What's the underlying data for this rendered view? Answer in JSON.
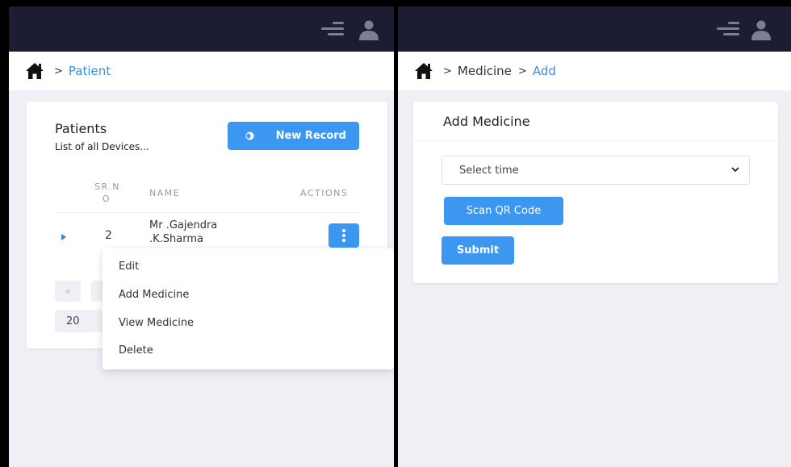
{
  "left": {
    "breadcrumb": {
      "current": "Patient"
    },
    "card": {
      "title": "Patients",
      "subtitle": "List of all Devices...",
      "new_record_label": "New Record",
      "columns": [
        "SR.N O",
        "NAME",
        "ACTIONS"
      ],
      "rows": [
        {
          "srno": "2",
          "name_line1": "Mr .Gajendra",
          "name_line2": ".K.Sharma"
        }
      ],
      "pager": {
        "first": "«",
        "page_size": "20"
      }
    },
    "row_menu": {
      "items": [
        "Edit",
        "Add Medicine",
        "View Medicine",
        "Delete"
      ]
    }
  },
  "right": {
    "breadcrumb": {
      "parent": "Medicine",
      "current": "Add"
    },
    "card": {
      "title": "Add Medicine",
      "select_value": "Select time",
      "scan_label": "Scan QR Code",
      "submit_label": "Submit"
    }
  },
  "colors": {
    "topbar": "#1c1d33",
    "accent": "#3b97f0",
    "link": "#3b8ee6",
    "page_bg": "#eef0f5"
  },
  "icons": [
    "menu-icon",
    "user-icon",
    "home-icon",
    "record-icon",
    "caret-right-icon",
    "kebab-icon",
    "chevron-down-icon"
  ]
}
